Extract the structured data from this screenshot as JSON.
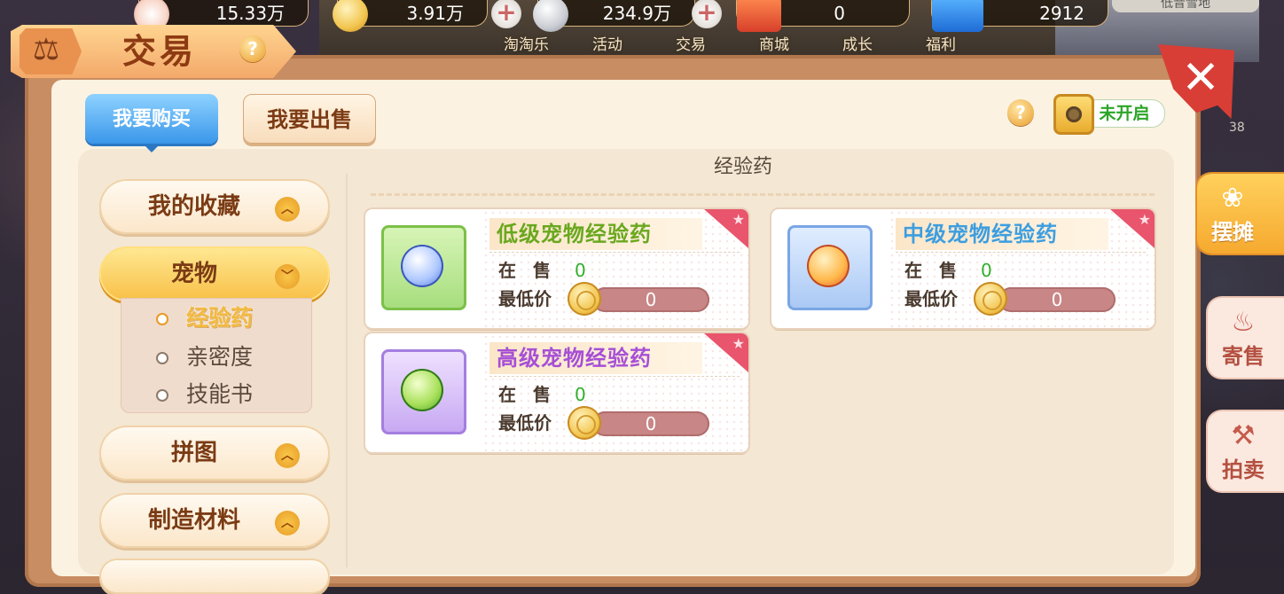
{
  "top_bar": {
    "resource_1": "15.33万",
    "resource_2": "3.91万",
    "resource_3": "234.9万",
    "resource_4": "0",
    "resource_5": "2912",
    "top_right_text": "低音雪地",
    "side_badge": "38",
    "nav": [
      "淘淘乐",
      "活动",
      "交易",
      "商城",
      "成长",
      "福利"
    ]
  },
  "header": {
    "title": "交易",
    "help": "?"
  },
  "tabs": {
    "buy": "我要购买",
    "sell": "我要出售"
  },
  "vault": {
    "status": "未开启",
    "help": "?"
  },
  "menu": {
    "items": [
      {
        "label": "我的收藏"
      },
      {
        "label": "宠物"
      },
      {
        "label": "拼图"
      },
      {
        "label": "制造材料"
      }
    ],
    "submenu": [
      "经验药",
      "亲密度",
      "技能书"
    ]
  },
  "category": {
    "title": "经验药"
  },
  "cards": [
    {
      "name": "低级宠物经验药",
      "sale_label": "在 售",
      "sale_count": "0",
      "price_label": "最低价",
      "price": "0",
      "name_color": "#6aa81e"
    },
    {
      "name": "中级宠物经验药",
      "sale_label": "在 售",
      "sale_count": "0",
      "price_label": "最低价",
      "price": "0",
      "name_color": "#3d9ee0"
    },
    {
      "name": "高级宠物经验药",
      "sale_label": "在 售",
      "sale_count": "0",
      "price_label": "最低价",
      "price": "0",
      "name_color": "#a64fd6"
    }
  ],
  "side_tabs": [
    "摆摊",
    "寄售",
    "拍卖"
  ],
  "colors": {
    "accent_blue": "#3a97ea",
    "accent_gold": "#f6a92f",
    "green_value": "#30b02c",
    "close_red": "#d83e36"
  }
}
